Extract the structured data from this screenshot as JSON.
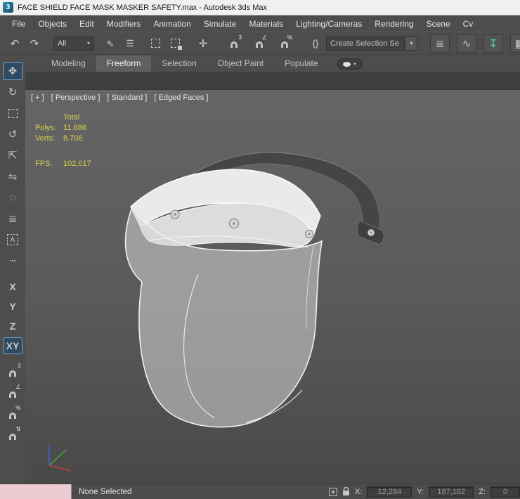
{
  "window": {
    "title": "FACE SHIELD FACE MASK MASKER SAFETY.max - Autodesk 3ds Max",
    "logo_text": "3"
  },
  "menu": {
    "items": [
      "File",
      "Objects",
      "Edit",
      "Modifiers",
      "Animation",
      "Simulate",
      "Materials",
      "Lighting/Cameras",
      "Rendering",
      "Scene",
      "Cv"
    ]
  },
  "toolbar": {
    "filter_value": "All",
    "named_sets_value": "Create Selection Se"
  },
  "ribbon": {
    "tabs": [
      "Modeling",
      "Freeform",
      "Selection",
      "Object Paint",
      "Populate"
    ],
    "active_tab": "Freeform"
  },
  "viewport": {
    "label_segments": [
      "[ + ]",
      "[ Perspective ]",
      "[ Standard ]",
      "[ Edged Faces ]"
    ],
    "stats": {
      "total_label": "Total",
      "polys_label": "Polys:",
      "polys_value": "11.686",
      "verts_label": "Verts:",
      "verts_value": "8.706",
      "fps_label": "FPS:",
      "fps_value": "102,017"
    }
  },
  "status_bar": {
    "selection_status": "None Selected",
    "x_label": "X:",
    "x_value": "12,284",
    "y_label": "Y:",
    "y_value": "187,162",
    "z_label": "Z:",
    "z_value": "0"
  },
  "icons": {
    "undo": "↶",
    "redo": "↷",
    "dropdown": "▾",
    "select_object": "⇖",
    "select_by_name": "☰",
    "move": "✛",
    "braces": "{}",
    "layers": "≣",
    "curve": "∿",
    "ribbon_toggle": "↧",
    "schematic": "▦",
    "side_move": "✥",
    "rotate": "↻",
    "orbit": "↺",
    "place": "⇱",
    "mirror": "⇋",
    "dotted_circle": "◌",
    "stack": "≣",
    "annotate": "A",
    "dashes": "┄",
    "axis_x": "X",
    "axis_y": "Y",
    "axis_z": "Z",
    "axis_xy": "XY",
    "snap_3": "3",
    "snap_angle": "∠",
    "snap_percent": "%",
    "snap_spinner": "⇅"
  },
  "colors": {
    "accent_blue": "#2f4a63",
    "accent_blue_border": "#7aa0c4",
    "stats_yellow": "#d8cf4e",
    "listener_pink": "#ecccd1",
    "teal_icon": "#53b99e"
  }
}
